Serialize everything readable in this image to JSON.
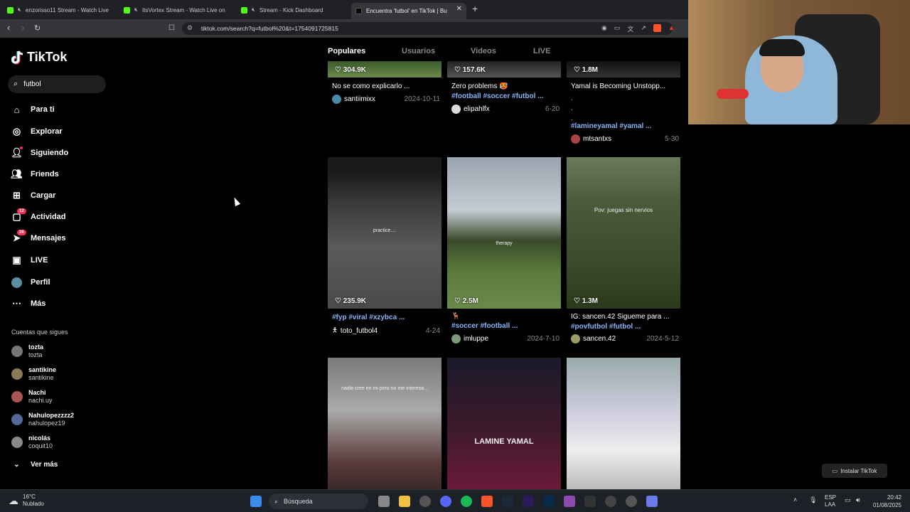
{
  "browser": {
    "tabs": [
      {
        "title": "enzorisso11 Stream - Watch Live"
      },
      {
        "title": "ItsVortex Stream - Watch Live on"
      },
      {
        "title": "Stream - Kick Dashboard"
      },
      {
        "title": "Encuentra 'futbol' en TikTok | Bu"
      }
    ],
    "new_tab": "+",
    "url": "tiktok.com/search?q=futbol%20&t=1754091725815"
  },
  "sidebar": {
    "logo_text": "TikTok",
    "search_value": "futbol",
    "nav": [
      {
        "label": "Para ti",
        "icon": "home-icon"
      },
      {
        "label": "Explorar",
        "icon": "compass-icon"
      },
      {
        "label": "Siguiendo",
        "icon": "user-follow-icon"
      },
      {
        "label": "Friends",
        "icon": "friends-icon"
      },
      {
        "label": "Cargar",
        "icon": "upload-icon"
      },
      {
        "label": "Actividad",
        "icon": "activity-icon",
        "badge": "12"
      },
      {
        "label": "Mensajes",
        "icon": "messages-icon",
        "badge": "36"
      },
      {
        "label": "LIVE",
        "icon": "live-icon"
      },
      {
        "label": "Perfil",
        "icon": "profile-icon"
      },
      {
        "label": "Más",
        "icon": "more-icon"
      }
    ],
    "following_header": "Cuentas que sigues",
    "following": [
      {
        "name": "tozta",
        "user": "tozta"
      },
      {
        "name": "santikine",
        "user": "santikine"
      },
      {
        "name": "Nachi",
        "user": "nachi.uy"
      },
      {
        "name": "Nahulopezzzz2",
        "user": "nahulopez19"
      },
      {
        "name": "nicolás",
        "user": "coquit10"
      }
    ],
    "see_more": "Ver más"
  },
  "topnav": {
    "tabs": [
      "Populares",
      "Usuarios",
      "Videos",
      "LIVE"
    ]
  },
  "videos": [
    {
      "likes": "304.9K",
      "caption": "No se como explicarlo ...",
      "tags": "",
      "user": "santiimixx",
      "date": "2024-10-11"
    },
    {
      "likes": "157.6K",
      "caption": "Zero problems 🥵",
      "tags": "#football #soccer #futbol ...",
      "user": "elipahlfx",
      "date": "6-20"
    },
    {
      "likes": "1.8M",
      "caption": "Yamal is Becoming Unstopp...",
      "tags": "#lamineyamal #yamal ...",
      "user": "mtsantxs",
      "date": "5-30"
    },
    {
      "likes": "235.9K",
      "caption": "",
      "tags": "#fyp #viral #xzybca ...",
      "user": "toto_futbol4",
      "date": "4-24",
      "overlay": "practice...."
    },
    {
      "likes": "2.5M",
      "caption": "🦌",
      "tags": "#soccer #football ...",
      "user": "imluppe",
      "date": "2024-7-10",
      "overlay": "therapy"
    },
    {
      "likes": "1.3M",
      "caption": "IG: sancen.42 Sigueme para ...",
      "tags": "#povfutbol #futbol ...",
      "user": "sancen.42",
      "date": "2024-5-12",
      "overlay": "Pov: juegas sin nervios"
    },
    {
      "overlay": "nadie cree en mi pero no me interesa..."
    },
    {
      "overlay": "LAMINE YAMAL"
    },
    {
      "overlay": ""
    }
  ],
  "install_button": "Instalar TikTok",
  "taskbar": {
    "temp": "16°C",
    "weather": "Nublado",
    "search": "Búsqueda",
    "lang1": "ESP",
    "lang2": "LAA",
    "time": "20:42",
    "date": "01/08/2025"
  }
}
